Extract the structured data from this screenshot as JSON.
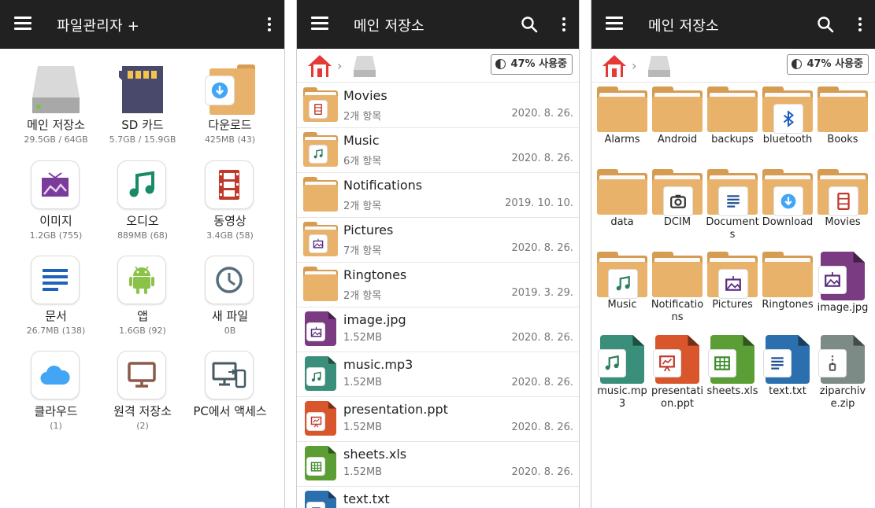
{
  "panel1": {
    "title": "파일관리자 +",
    "items": [
      {
        "label": "메인 저장소",
        "sub": "29.5GB / 64GB",
        "icon": "hard-drive-icon"
      },
      {
        "label": "SD 카드",
        "sub": "5.7GB / 15.9GB",
        "icon": "sd-card-icon"
      },
      {
        "label": "다운로드",
        "sub": "425MB (43)",
        "icon": "download-folder-icon"
      },
      {
        "label": "이미지",
        "sub": "1.2GB (755)",
        "icon": "image-icon"
      },
      {
        "label": "오디오",
        "sub": "889MB (68)",
        "icon": "music-note-icon"
      },
      {
        "label": "동영상",
        "sub": "3.4GB (58)",
        "icon": "film-icon"
      },
      {
        "label": "문서",
        "sub": "26.7MB (138)",
        "icon": "document-icon"
      },
      {
        "label": "앱",
        "sub": "1.6GB (92)",
        "icon": "android-icon"
      },
      {
        "label": "새 파일",
        "sub": "0B",
        "icon": "clock-icon"
      },
      {
        "label": "클라우드",
        "sub": "(1)",
        "icon": "cloud-icon"
      },
      {
        "label": "원격 저장소",
        "sub": "(2)",
        "icon": "monitor-icon"
      },
      {
        "label": "PC에서 액세스",
        "sub": "",
        "icon": "pc-phone-icon"
      }
    ]
  },
  "panel2": {
    "title": "메인 저장소",
    "usage": "47% 사용중",
    "rows": [
      {
        "name": "Movies",
        "meta": "2개 항목",
        "date": "2020. 8. 26.",
        "kind": "folder",
        "badge": "film"
      },
      {
        "name": "Music",
        "meta": "6개 항목",
        "date": "2020. 8. 26.",
        "kind": "folder",
        "badge": "music"
      },
      {
        "name": "Notifications",
        "meta": "2개 항목",
        "date": "2019. 10. 10.",
        "kind": "folder",
        "badge": ""
      },
      {
        "name": "Pictures",
        "meta": "7개 항목",
        "date": "2020. 8. 26.",
        "kind": "folder",
        "badge": "image"
      },
      {
        "name": "Ringtones",
        "meta": "2개 항목",
        "date": "2019. 3. 29.",
        "kind": "folder",
        "badge": ""
      },
      {
        "name": "image.jpg",
        "meta": "1.52MB",
        "date": "2020. 8. 26.",
        "kind": "file",
        "color": "#7b3b83",
        "badge": "image"
      },
      {
        "name": "music.mp3",
        "meta": "1.52MB",
        "date": "2020. 8. 26.",
        "kind": "file",
        "color": "#3a8f7a",
        "badge": "music"
      },
      {
        "name": "presentation.ppt",
        "meta": "1.52MB",
        "date": "2020. 8. 26.",
        "kind": "file",
        "color": "#d9552b",
        "badge": "ppt"
      },
      {
        "name": "sheets.xls",
        "meta": "1.52MB",
        "date": "2020. 8. 26.",
        "kind": "file",
        "color": "#5a9e35",
        "badge": "xls"
      },
      {
        "name": "text.txt",
        "meta": "",
        "date": "",
        "kind": "file",
        "color": "#2c6fae",
        "badge": "text"
      }
    ]
  },
  "panel3": {
    "title": "메인 저장소",
    "usage": "47% 사용중",
    "items": [
      {
        "label": "Alarms",
        "kind": "folder",
        "badge": ""
      },
      {
        "label": "Android",
        "kind": "folder",
        "badge": ""
      },
      {
        "label": "backups",
        "kind": "folder",
        "badge": ""
      },
      {
        "label": "bluetooth",
        "kind": "folder",
        "badge": "bluetooth"
      },
      {
        "label": "Books",
        "kind": "folder",
        "badge": ""
      },
      {
        "label": "data",
        "kind": "folder",
        "badge": ""
      },
      {
        "label": "DCIM",
        "kind": "folder",
        "badge": "camera"
      },
      {
        "label": "Documents",
        "kind": "folder",
        "badge": "text"
      },
      {
        "label": "Download",
        "kind": "folder",
        "badge": "download"
      },
      {
        "label": "Movies",
        "kind": "folder",
        "badge": "film"
      },
      {
        "label": "Music",
        "kind": "folder",
        "badge": "music"
      },
      {
        "label": "Notifications",
        "kind": "folder",
        "badge": ""
      },
      {
        "label": "Pictures",
        "kind": "folder",
        "badge": "image"
      },
      {
        "label": "Ringtones",
        "kind": "folder",
        "badge": ""
      },
      {
        "label": "image.jpg",
        "kind": "file",
        "color": "#7b3b83",
        "badge": "image"
      },
      {
        "label": "music.mp3",
        "kind": "file",
        "color": "#3a8f7a",
        "badge": "music"
      },
      {
        "label": "presentation.ppt",
        "kind": "file",
        "color": "#d9552b",
        "badge": "ppt"
      },
      {
        "label": "sheets.xls",
        "kind": "file",
        "color": "#5a9e35",
        "badge": "xls"
      },
      {
        "label": "text.txt",
        "kind": "file",
        "color": "#2c6fae",
        "badge": "text"
      },
      {
        "label": "ziparchive.zip",
        "kind": "file",
        "color": "#7d8b87",
        "badge": "zip"
      }
    ]
  },
  "colors": {
    "appbar": "#212121",
    "folder": "#e9b26b",
    "home_roof": "#e53935"
  }
}
